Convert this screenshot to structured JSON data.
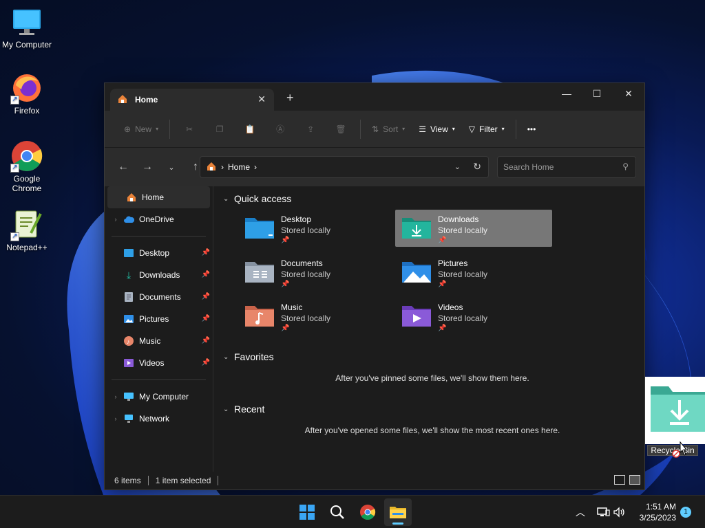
{
  "desktop": {
    "icons": [
      {
        "label": "My Computer",
        "icon": "monitor-icon"
      },
      {
        "label": "Firefox",
        "icon": "firefox-icon"
      },
      {
        "label": "Google Chrome",
        "icon": "chrome-icon"
      },
      {
        "label": "Notepad++",
        "icon": "notepad-plus-plus-icon"
      }
    ]
  },
  "window": {
    "tab_label": "Home",
    "toolbar": {
      "new_label": "New",
      "sort_label": "Sort",
      "view_label": "View",
      "filter_label": "Filter",
      "more_label": "•••"
    },
    "address": {
      "crumb": "Home",
      "search_placeholder": "Search Home"
    },
    "sidebar": {
      "top": [
        {
          "label": "Home",
          "icon": "home-icon"
        },
        {
          "label": "OneDrive",
          "icon": "cloud-icon"
        }
      ],
      "pinned": [
        {
          "label": "Desktop",
          "icon": "desktop-folder-icon"
        },
        {
          "label": "Downloads",
          "icon": "download-icon"
        },
        {
          "label": "Documents",
          "icon": "documents-icon"
        },
        {
          "label": "Pictures",
          "icon": "pictures-icon"
        },
        {
          "label": "Music",
          "icon": "music-icon"
        },
        {
          "label": "Videos",
          "icon": "videos-icon"
        }
      ],
      "bottom": [
        {
          "label": "My Computer",
          "icon": "monitor-icon"
        },
        {
          "label": "Network",
          "icon": "network-icon"
        }
      ]
    },
    "quick_access": {
      "title": "Quick access",
      "items": [
        {
          "name": "Desktop",
          "status": "Stored locally",
          "color": "#2e9fe6"
        },
        {
          "name": "Downloads",
          "status": "Stored locally",
          "color": "#23b59d"
        },
        {
          "name": "Documents",
          "status": "Stored locally",
          "color": "#a9b4c2"
        },
        {
          "name": "Pictures",
          "status": "Stored locally",
          "color": "#2f8fe8"
        },
        {
          "name": "Music",
          "status": "Stored locally",
          "color": "#e8866a"
        },
        {
          "name": "Videos",
          "status": "Stored locally",
          "color": "#8a5ad8"
        }
      ]
    },
    "favorites": {
      "title": "Favorites",
      "empty": "After you've pinned some files, we'll show them here."
    },
    "recent": {
      "title": "Recent",
      "empty": "After you've opened some files, we'll show the most recent ones here."
    },
    "status": {
      "count": "6 items",
      "selection": "1 item selected"
    }
  },
  "drag": {
    "label": "Recycle Bin"
  },
  "taskbar": {
    "time": "1:51 AM",
    "date": "3/25/2023",
    "notification_count": "1"
  }
}
